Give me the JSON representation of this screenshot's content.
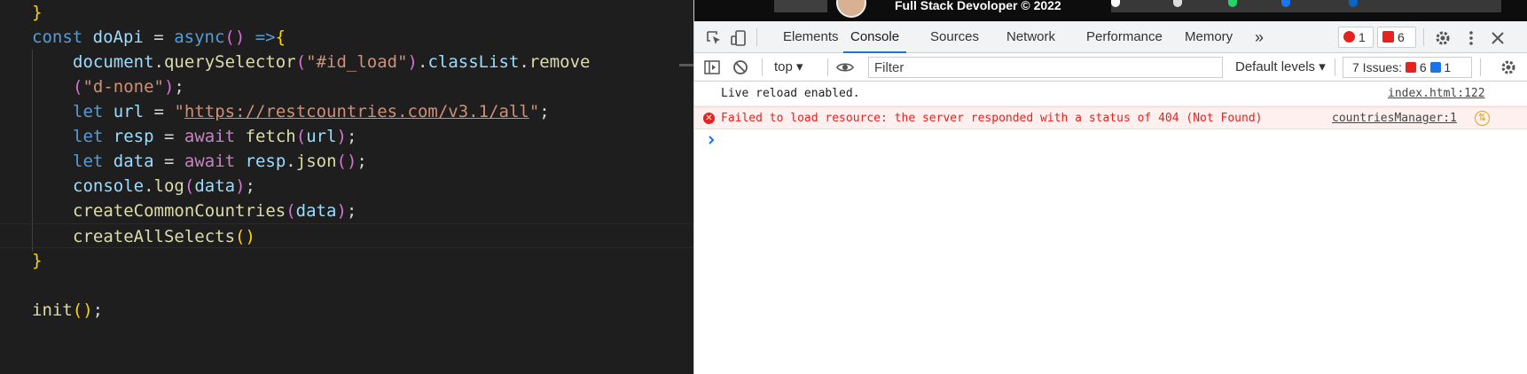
{
  "editor": {
    "lines": {
      "l1": {
        "close": "}"
      },
      "l2": {
        "kw": "const",
        "name": "doApi",
        "eq": " = ",
        "async": "async",
        "parens": "()",
        "arrow": " =>",
        "open": "{"
      },
      "l3": {
        "doc": "document",
        "dot": ".",
        "qs": "querySelector",
        "p1": "(",
        "s": "\"#id_load\"",
        "p2": ")",
        "cl": "classList",
        "rm": "remove"
      },
      "l4": {
        "p1": "(",
        "s": "\"d-none\"",
        "p2": ")",
        "semi": ";"
      },
      "l5": {
        "kw": "let",
        "v": "url",
        "eq": " = ",
        "q1": "\"",
        "url": "https://restcountries.com/v3.1/all",
        "q2": "\"",
        "semi": ";"
      },
      "l6": {
        "kw": "let",
        "v": "resp",
        "eq": " = ",
        "aw": "await",
        "fn": "fetch",
        "p1": "(",
        "a": "url",
        "p2": ")",
        "semi": ";"
      },
      "l7": {
        "kw": "let",
        "v": "data",
        "eq": " = ",
        "aw": "await",
        "obj": "resp",
        "fn": "json",
        "p": "()",
        "semi": ";"
      },
      "l8": {
        "obj": "console",
        "fn": "log",
        "p1": "(",
        "a": "data",
        "p2": ")",
        "semi": ";"
      },
      "l9": {
        "fn": "createCommonCountries",
        "p1": "(",
        "a": "data",
        "p2": ")",
        "semi": ";"
      },
      "l10": {
        "fn": "createAllSelects",
        "p": "()"
      },
      "l11": {
        "close": "}"
      },
      "l13": {
        "fn": "init",
        "p": "()",
        "semi": ";"
      }
    }
  },
  "devtools": {
    "banner": {
      "text": "Full Stack Devoloper © 2022"
    },
    "tabs": [
      "Elements",
      "Console",
      "Sources",
      "Network",
      "Performance",
      "Memory"
    ],
    "active_tab": "Console",
    "more_tabs": "»",
    "error_count": "1",
    "warning_count": "6",
    "toolbar": {
      "context": "top",
      "filter_placeholder": "Filter",
      "levels": "Default levels",
      "issues_label": "7 Issues:",
      "issues_errors": "6",
      "issues_info": "1"
    },
    "messages": [
      {
        "type": "log",
        "text": "Live reload enabled.",
        "source": "index.html:122"
      },
      {
        "type": "error",
        "text": "Failed to load resource: the server responded with a status of 404 (Not Found)",
        "source": "countriesManager:1"
      }
    ],
    "colors": {
      "accent": "#1a73e8",
      "error": "#e4231e",
      "error_bg": "#fff0f0"
    },
    "icons": [
      "inspect-icon",
      "device-toggle-icon",
      "sidebar-toggle-icon",
      "clear-console-icon",
      "eye-icon",
      "settings-icon",
      "kebab-menu-icon",
      "close-icon",
      "console-settings-icon",
      "error-icon",
      "network-warning-icon",
      "prompt-chevron-icon"
    ]
  }
}
